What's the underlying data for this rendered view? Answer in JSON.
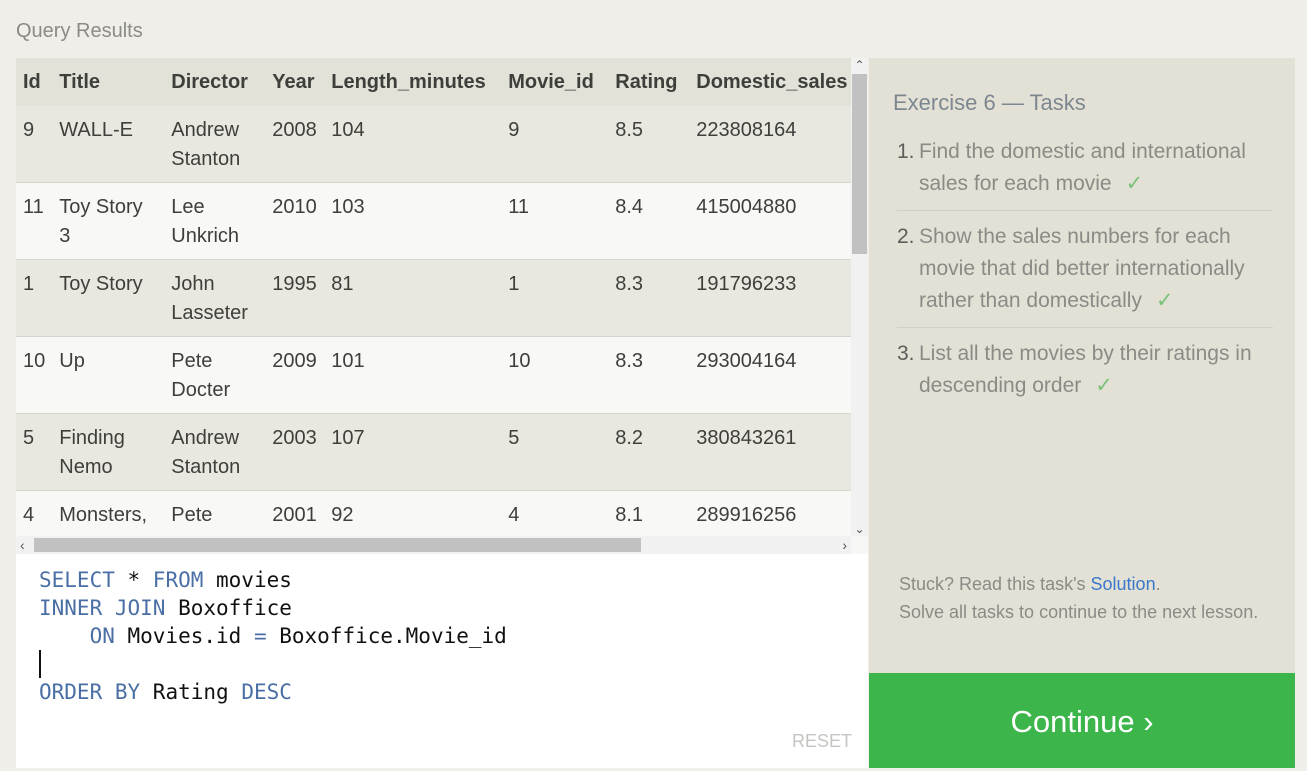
{
  "heading": "Query Results",
  "table": {
    "columns": [
      "Id",
      "Title",
      "Director",
      "Year",
      "Length_minutes",
      "Movie_id",
      "Rating",
      "Domestic_sales"
    ],
    "rows": [
      [
        "9",
        "WALL-E",
        "Andrew Stanton",
        "2008",
        "104",
        "9",
        "8.5",
        "223808164"
      ],
      [
        "11",
        "Toy Story 3",
        "Lee Unkrich",
        "2010",
        "103",
        "11",
        "8.4",
        "415004880"
      ],
      [
        "1",
        "Toy Story",
        "John Lasseter",
        "1995",
        "81",
        "1",
        "8.3",
        "191796233"
      ],
      [
        "10",
        "Up",
        "Pete Docter",
        "2009",
        "101",
        "10",
        "8.3",
        "293004164"
      ],
      [
        "5",
        "Finding Nemo",
        "Andrew Stanton",
        "2003",
        "107",
        "5",
        "8.2",
        "380843261"
      ],
      [
        "4",
        "Monsters, Inc.",
        "Pete Docter",
        "2001",
        "92",
        "4",
        "8.1",
        "289916256"
      ]
    ]
  },
  "editor": {
    "lines": [
      [
        {
          "t": "SELECT",
          "k": true
        },
        {
          "t": " * ",
          "k": false
        },
        {
          "t": "FROM",
          "k": true
        },
        {
          "t": " movies",
          "k": false
        }
      ],
      [
        {
          "t": "INNER JOIN",
          "k": true
        },
        {
          "t": " Boxoffice",
          "k": false
        }
      ],
      [
        {
          "t": "    ON",
          "k": true
        },
        {
          "t": " Movies.id ",
          "k": false
        },
        {
          "t": "=",
          "k": true
        },
        {
          "t": " Boxoffice.Movie_id",
          "k": false
        }
      ],
      [],
      [
        {
          "t": "ORDER BY",
          "k": true
        },
        {
          "t": " Rating ",
          "k": false
        },
        {
          "t": "DESC",
          "k": true
        }
      ]
    ],
    "reset_label": "RESET"
  },
  "tasks": {
    "title": "Exercise 6 — Tasks",
    "items": [
      {
        "num": "1.",
        "text": "Find the domestic and international sales for each movie",
        "done": "✓"
      },
      {
        "num": "2.",
        "text": "Show the sales numbers for each movie that did better internationally rather than domestically",
        "done": "✓"
      },
      {
        "num": "3.",
        "text": "List all the movies by their ratings in descending order",
        "done": "✓"
      }
    ],
    "stuck_prefix": "Stuck? Read this task's ",
    "solution_link": "Solution",
    "stuck_suffix": ".",
    "stuck_line2": "Solve all tasks to continue to the next lesson."
  },
  "continue_label": "Continue ›",
  "colors": {
    "accent": "#3cb54a",
    "link": "#3a78c9",
    "keyword": "#4a6fa5",
    "check": "#7ac27a"
  }
}
